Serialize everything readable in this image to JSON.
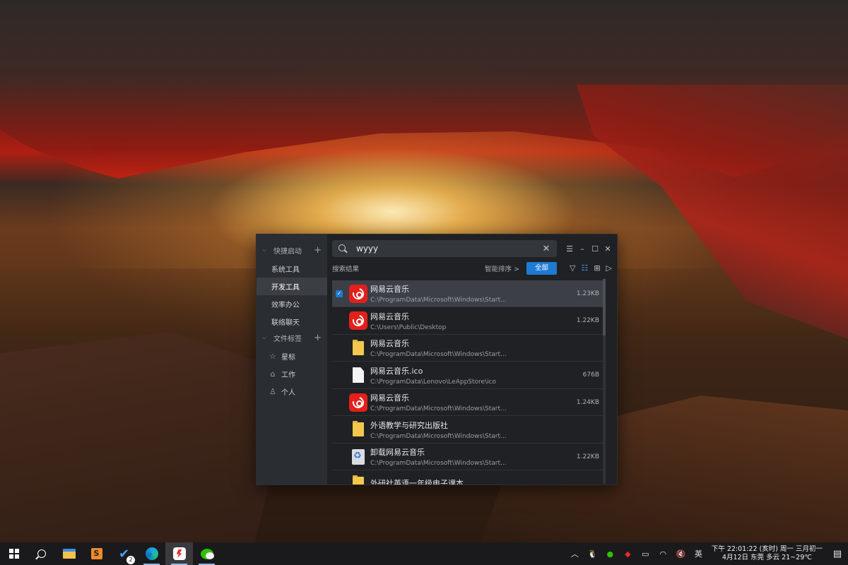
{
  "app": {
    "search": {
      "value": "wyyy",
      "placeholder": ""
    },
    "sidebar": {
      "quick_launch": {
        "label": "快捷启动",
        "items": [
          "系统工具",
          "开发工具",
          "效率办公",
          "联络聊天"
        ],
        "active_index": 1
      },
      "file_tags": {
        "label": "文件标签",
        "items": [
          {
            "label": "星标",
            "icon": "star-icon"
          },
          {
            "label": "工作",
            "icon": "home-icon"
          },
          {
            "label": "个人",
            "icon": "person-icon"
          }
        ]
      }
    },
    "filter": {
      "results_label": "搜索结果",
      "sort_label": "智能排序 >",
      "all_button": "全部"
    },
    "results": [
      {
        "name": "网易云音乐",
        "path": "C:\\ProgramData\\Microsoft\\Windows\\Start...",
        "size": "1.23KB",
        "icon": "netease-music-icon",
        "selected": true
      },
      {
        "name": "网易云音乐",
        "path": "C:\\Users\\Public\\Desktop",
        "size": "1.22KB",
        "icon": "netease-music-icon",
        "selected": false
      },
      {
        "name": "网易云音乐",
        "path": "C:\\ProgramData\\Microsoft\\Windows\\Start...",
        "size": "",
        "icon": "folder-icon",
        "selected": false
      },
      {
        "name": "网易云音乐.ico",
        "path": "C:\\ProgramData\\Lenovo\\LeAppStore\\ico",
        "size": "676B",
        "icon": "file-icon",
        "selected": false
      },
      {
        "name": "网易云音乐",
        "path": "C:\\ProgramData\\Microsoft\\Windows\\Start...",
        "size": "1.24KB",
        "icon": "netease-music-icon",
        "selected": false
      },
      {
        "name": "外语教学与研究出版社",
        "path": "C:\\ProgramData\\Microsoft\\Windows\\Start...",
        "size": "",
        "icon": "folder-icon",
        "selected": false
      },
      {
        "name": "卸载网易云音乐",
        "path": "C:\\ProgramData\\Microsoft\\Windows\\Start...",
        "size": "1.22KB",
        "icon": "recycle-bin-icon",
        "selected": false
      },
      {
        "name": "外研社英语一年级电子课本",
        "path": "",
        "size": "",
        "icon": "folder-icon",
        "selected": false
      }
    ]
  },
  "taskbar": {
    "apps": [
      "windows-start-icon",
      "search-icon",
      "file-explorer-icon",
      "sublime-text-icon",
      "todo-icon",
      "edge-icon",
      "listary-icon",
      "wechat-icon"
    ],
    "todo_badge": "2",
    "ime": "英",
    "clock_line1": "下午 22:01:22 (亥时) 周一 三月初一",
    "clock_line2": "4月12日 东莞 多云 21~29℃"
  },
  "colors": {
    "accent": "#1f7ad4",
    "window_bg": "#1f2124",
    "sidebar_bg": "#2a2d31",
    "netease_red": "#e3201b"
  }
}
